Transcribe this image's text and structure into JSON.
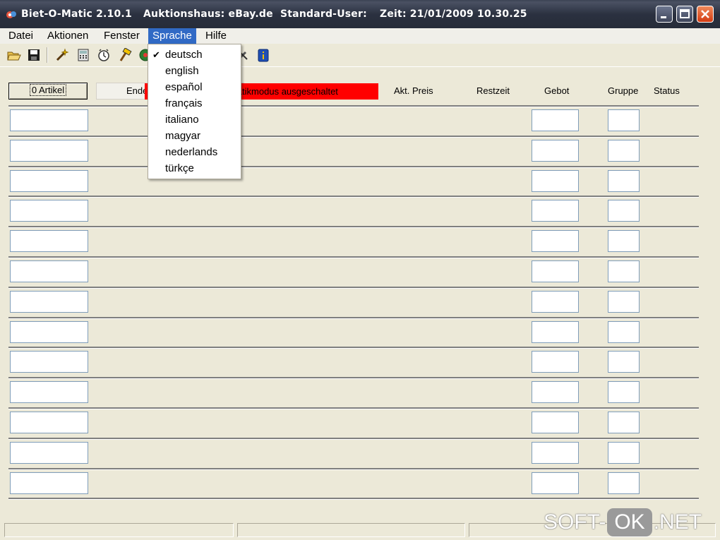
{
  "window": {
    "app_title": "Biet-O-Matic 2.10.1",
    "auction_house": "Auktionshaus: eBay.de",
    "user": "Standard-User:",
    "time": "Zeit: 21/01/2009 10.30.25"
  },
  "menu": {
    "items": [
      "Datei",
      "Aktionen",
      "Fenster",
      "Sprache",
      "Hilfe"
    ],
    "open_menu": "Sprache"
  },
  "language_menu": {
    "items": [
      {
        "label": "deutsch",
        "checked": true
      },
      {
        "label": "english",
        "checked": false
      },
      {
        "label": "español",
        "checked": false
      },
      {
        "label": "français",
        "checked": false
      },
      {
        "label": "italiano",
        "checked": false
      },
      {
        "label": "magyar",
        "checked": false
      },
      {
        "label": "nederlands",
        "checked": false
      },
      {
        "label": "türkçe",
        "checked": false
      }
    ],
    "check_mark": "✔"
  },
  "toolbar": {
    "icons": [
      "open-folder-icon",
      "save-icon",
      "wizard-icon",
      "calculator-icon",
      "clock-icon",
      "hammer-icon",
      "traffic-icon",
      "tools-icon",
      "info-icon"
    ]
  },
  "header": {
    "articles_button": "0 Artikel",
    "end_column": "Ende",
    "mode_indicator": "matikmodus ausgeschaltet",
    "mode_color": "#FF0000",
    "columns": {
      "price": "Akt. Preis",
      "remaining": "Restzeit",
      "bid": "Gebot",
      "group": "Gruppe",
      "status": "Status"
    }
  },
  "rows": {
    "count": 13
  },
  "watermark": {
    "left": "SOFT-",
    "middle": "OK",
    "right": ".NET"
  },
  "colors": {
    "menu_highlight": "#316AC5",
    "window_bg": "#ECE9D8",
    "close_button": "#D33B12"
  }
}
